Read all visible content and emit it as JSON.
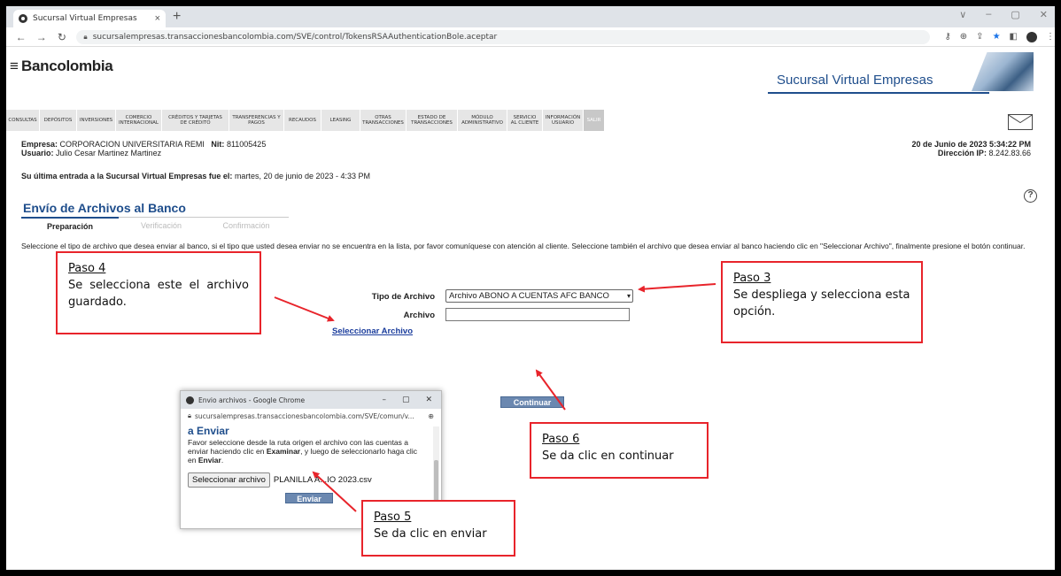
{
  "browser": {
    "tab_title": "Sucursal Virtual Empresas",
    "tab_close": "×",
    "new_tab": "+",
    "window_controls": [
      "∨",
      "–",
      "▢",
      "✕"
    ],
    "url": "sucursalempresas.transaccionesbancolombia.com/SVE/control/TokensRSAAuthenticationBole.aceptar"
  },
  "header": {
    "logo": "Bancolombia",
    "banner": "Sucursal Virtual Empresas"
  },
  "menu": [
    "CONSULTAS",
    "DEPÓSITOS",
    "INVERSIONES",
    "COMERCIO INTERNACIONAL",
    "CRÉDITOS Y TARJETAS DE CRÉDITO",
    "TRANSFERENCIAS Y PAGOS",
    "RECAUDOS",
    "LEASING",
    "OTRAS TRANSACCIONES",
    "ESTADO DE TRANSACCIONES",
    "MÓDULO ADMINISTRATIVO",
    "SERVICIO AL CLIENTE",
    "INFORMACIÓN USUARIO",
    "SALIR"
  ],
  "session": {
    "empresa_label": "Empresa:",
    "empresa": "CORPORACION UNIVERSITARIA REMI",
    "nit_label": "Nit:",
    "nit": "811005425",
    "usuario_label": "Usuario:",
    "usuario": "Julio Cesar Martinez Martinez",
    "datetime": "20 de Junio de 2023 5:34:22 PM",
    "ip_label": "Dirección IP:",
    "ip": "8.242.83.66",
    "last_login_label": "Su última entrada a la Sucursal Virtual Empresas fue el:",
    "last_login": "martes, 20 de junio de 2023 - 4:33 PM"
  },
  "page": {
    "title": "Envío de Archivos al Banco",
    "steps": [
      "Preparación",
      "Verificación",
      "Confirmación"
    ],
    "instructions": "Seleccione el tipo de archivo que desea enviar al banco, si el tipo que usted desea enviar no se encuentra en la lista, por favor comuníquese con atención al cliente. Seleccione también el archivo que desea enviar al banco haciendo clic en \"Seleccionar Archivo\", finalmente presione el botón continuar.",
    "tipo_label": "Tipo de Archivo",
    "tipo_value": "Archivo ABONO A CUENTAS AFC BANCO",
    "archivo_label": "Archivo",
    "select_link": "Seleccionar Archivo",
    "continue_button": "Continuar"
  },
  "popup": {
    "window_title": "Envio archivos - Google Chrome",
    "url": "sucursalempresas.transaccionesbancolombia.com/SVE/comun/v...",
    "heading": "a Enviar",
    "text_1": "Favor seleccione desde la ruta origen el archivo con las cuentas a enviar haciendo clic en ",
    "text_bold_1": "Examinar",
    "text_2": ", y luego de seleccionarlo haga clic en ",
    "text_bold_2": "Enviar",
    "text_3": ".",
    "file_button": "Seleccionar archivo",
    "file_name": "PLANILLA A...IO 2023.csv",
    "send_button": "Enviar"
  },
  "annotations": {
    "paso4": {
      "title": "Paso 4",
      "text": "Se selecciona este el archivo guardado."
    },
    "paso3": {
      "title": "Paso 3",
      "text": "Se despliega y selecciona esta opción."
    },
    "paso6": {
      "title": "Paso 6",
      "text": "Se da clic en continuar"
    },
    "paso5": {
      "title": "Paso 5",
      "text": "Se da clic en enviar"
    }
  },
  "colors": {
    "brand_blue": "#1f4e8c",
    "annotation_red": "#e8242b",
    "button_blue": "#6b88b0"
  }
}
